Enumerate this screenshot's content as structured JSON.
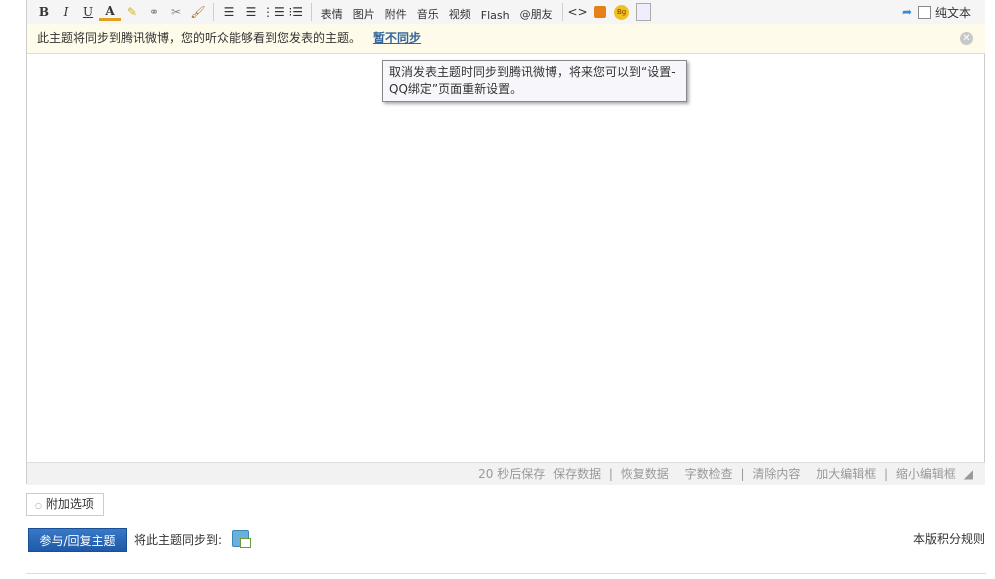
{
  "toolbar": {
    "format": [
      {
        "label": "B",
        "icon": "bold-icon"
      },
      {
        "label": "I",
        "icon": "italic-icon"
      },
      {
        "label": "U",
        "icon": "underline-icon"
      },
      {
        "label": "A",
        "icon": "font-color-icon"
      }
    ],
    "icons": [
      "spellcheck-icon",
      "link-icon",
      "unlink-icon",
      "clear-format-icon",
      "align-left-icon",
      "align-right-icon",
      "ordered-list-icon",
      "unordered-list-icon"
    ],
    "labels": [
      "表情",
      "图片",
      "附件",
      "音乐",
      "视频",
      "Flash",
      "@朋友"
    ],
    "extra_icons": [
      "code-icon",
      "quote-icon",
      "bg-icon",
      "image-icon"
    ],
    "plain_text": "纯文本"
  },
  "notice": {
    "text": "此主题将同步到腾讯微博，您的听众能够看到您发表的主题。",
    "link": "暂不同步"
  },
  "tooltip": "取消发表主题时同步到腾讯微博，将来您可以到“设置-QQ绑定”页面重新设置。",
  "status": {
    "autosave": "20 秒后保存",
    "save": "保存数据",
    "restore": "恢复数据",
    "count": "字数检查",
    "clear": "清除内容",
    "enlarge": "加大编辑框",
    "shrink": "缩小编辑框",
    "sep": "|"
  },
  "attach_label": "附加选项",
  "submit_label": "参与/回复主题",
  "sync_label": "将此主题同步到:",
  "rules_link": "本版积分规则"
}
